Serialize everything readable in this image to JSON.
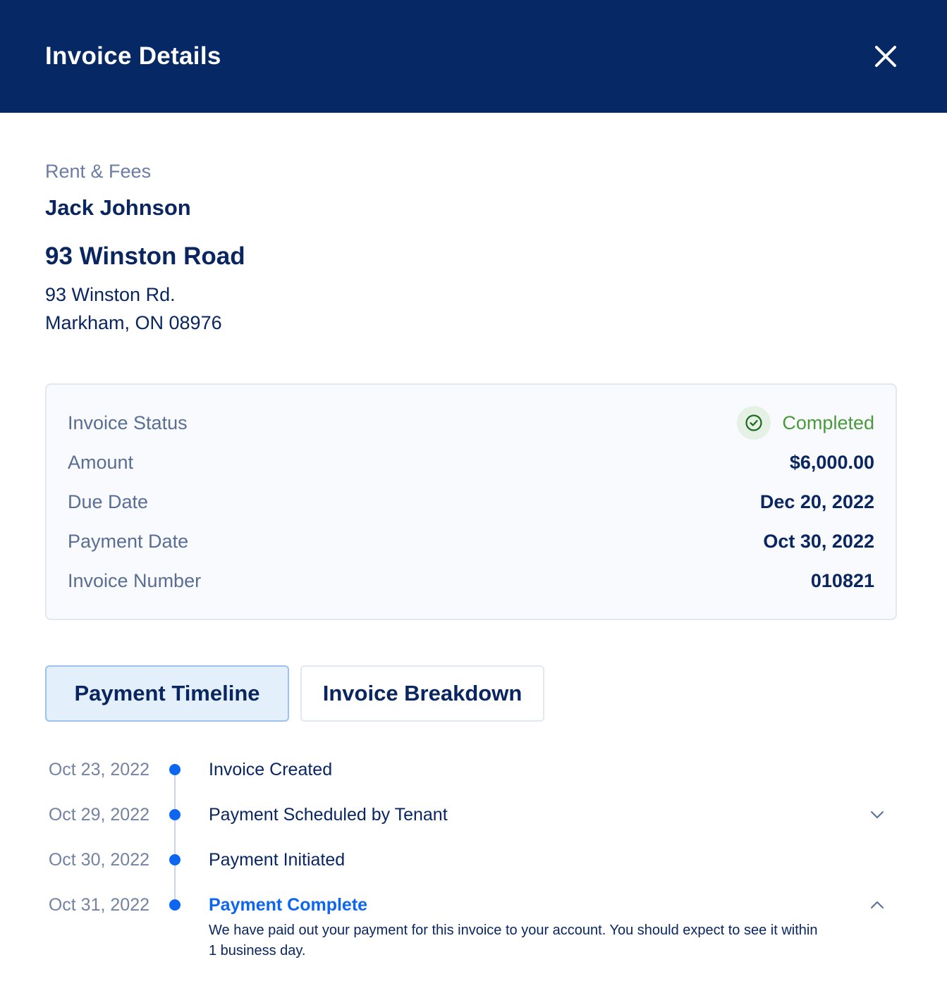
{
  "header": {
    "title": "Invoice Details",
    "close_icon": "close-icon"
  },
  "summary": {
    "category": "Rent & Fees",
    "tenant_name": "Jack Johnson",
    "property_name": "93 Winston Road",
    "address_line1": "93 Winston Rd.",
    "address_line2": "Markham, ON 08976"
  },
  "details": {
    "status_label": "Invoice Status",
    "status_value": "Completed",
    "status_icon": "check-circle-icon",
    "status_color": "#4a9a3c",
    "amount_label": "Amount",
    "amount_value": "$6,000.00",
    "due_date_label": "Due Date",
    "due_date_value": "Dec 20, 2022",
    "payment_date_label": "Payment Date",
    "payment_date_value": "Oct 30, 2022",
    "invoice_number_label": "Invoice Number",
    "invoice_number_value": "010821"
  },
  "tabs": [
    {
      "label": "Payment Timeline",
      "active": true
    },
    {
      "label": "Invoice Breakdown",
      "active": false
    }
  ],
  "timeline": {
    "accent_color": "#0d66f0",
    "events": [
      {
        "date": "Oct 23, 2022",
        "label": "Invoice Created"
      },
      {
        "date": "Oct 29, 2022",
        "label": "Payment Scheduled by Tenant",
        "toggle_icon": "chevron-down-icon"
      },
      {
        "date": "Oct 30, 2022",
        "label": "Payment Initiated"
      },
      {
        "date": "Oct 31, 2022",
        "label": "Payment Complete",
        "toggle_icon": "chevron-up-icon",
        "expanded": true,
        "description": "We have paid out your payment for this invoice to your account. You should expect to see it within 1 business day."
      }
    ]
  }
}
